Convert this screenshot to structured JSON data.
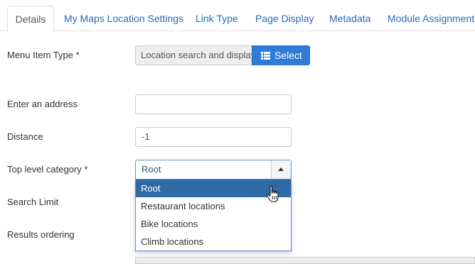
{
  "tabs": [
    {
      "label": "Details",
      "active": true
    },
    {
      "label": "My Maps Location Settings",
      "active": false
    },
    {
      "label": "Link Type",
      "active": false
    },
    {
      "label": "Page Display",
      "active": false
    },
    {
      "label": "Metadata",
      "active": false
    },
    {
      "label": "Module Assignment",
      "active": false
    }
  ],
  "form": {
    "menu_item_type": {
      "label": "Menu Item Type *",
      "value": "Location search and display",
      "button_label": "Select",
      "button_icon": "list-icon"
    },
    "address": {
      "label": "Enter an address",
      "value": ""
    },
    "distance": {
      "label": "Distance",
      "value": "-1"
    },
    "top_category": {
      "label": "Top level category *",
      "selected": "Root",
      "options": [
        "Root",
        "Restaurant locations",
        "Bike locations",
        "Climb locations"
      ],
      "highlighted_index": 0
    },
    "search_limit": {
      "label": "Search Limit"
    },
    "results_ordering": {
      "label": "Results ordering"
    }
  },
  "colors": {
    "link": "#2a69b8",
    "primary_button": "#2f7cd6",
    "highlight": "#2f6ba6"
  }
}
